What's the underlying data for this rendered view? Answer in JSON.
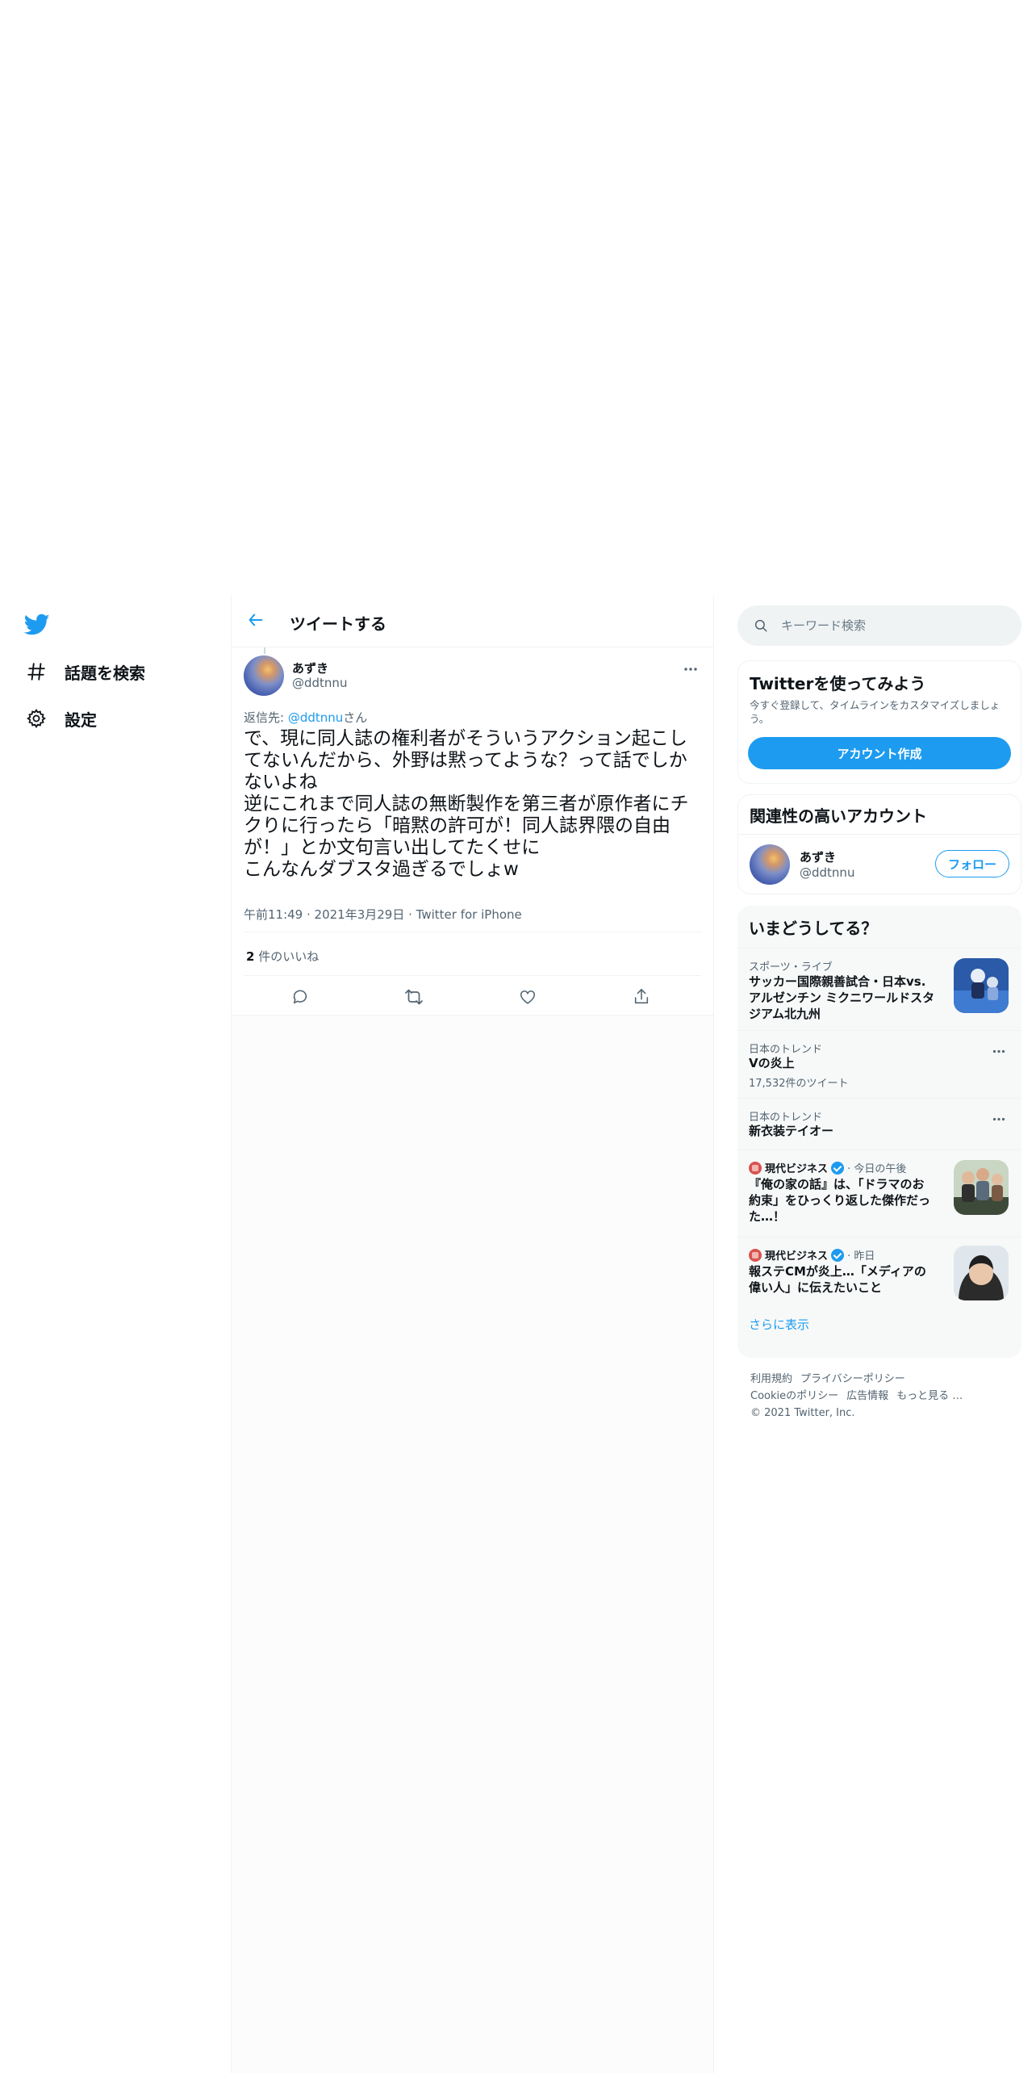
{
  "nav": {
    "logo": "twitter-bird-icon",
    "items": [
      {
        "label": "話題を検索",
        "icon": "hashtag-icon"
      },
      {
        "label": "設定",
        "icon": "gear-icon"
      }
    ]
  },
  "header": {
    "title": "ツイートする",
    "back_icon": "arrow-left-icon"
  },
  "tweet": {
    "display_name": "あずき",
    "handle": "@ddtnnu",
    "reply_prefix": "返信先: ",
    "reply_handle": "@ddtnnu",
    "reply_suffix": "さん",
    "body": "で、現に同人誌の権利者がそういうアクション起こしてないんだから、外野は黙ってような？って話でしかないよね\n逆にこれまで同人誌の無断製作を第三者が原作者にチクりに行ったら「暗黙の許可が！同人誌界隈の自由が！」とか文句言い出してたくせに\nこんなんダブスタ過ぎるでしょw",
    "time": "午前11:49",
    "date": "2021年3月29日",
    "source": "Twitter for iPhone",
    "like_count": "2",
    "like_label": " 件のいいね"
  },
  "search": {
    "placeholder": "キーワード検索"
  },
  "signup": {
    "title": "Twitterを使ってみよう",
    "text": "今すぐ登録して、タイムラインをカスタマイズしましょう。",
    "button": "アカウント作成"
  },
  "related": {
    "title": "関連性の高いアカウント",
    "name": "あずき",
    "handle": "@ddtnnu",
    "follow": "フォロー"
  },
  "trends": {
    "title": "いまどうしてる？",
    "items": [
      {
        "context": "スポーツ・ライブ",
        "title": "サッカー国際親善試合・日本vs.アルゼンチン ミクニワールドスタジアム北九州"
      },
      {
        "context": "日本のトレンド",
        "title": "Vの炎上",
        "count": "17,532件のツイート"
      },
      {
        "context": "日本のトレンド",
        "title": "新衣装テイオー"
      },
      {
        "publisher": "現代ビジネス",
        "when": "今日の午後",
        "title": "『俺の家の話』は、「ドラマのお約束」をひっくり返した傑作だった…！"
      },
      {
        "publisher": "現代ビジネス",
        "when": "昨日",
        "title": "報ステCMが炎上…「メディアの偉い人」に伝えたいこと"
      }
    ],
    "show_more": "さらに表示"
  },
  "footer": {
    "links": [
      "利用規約",
      "プライバシーポリシー",
      "Cookieのポリシー",
      "広告情報",
      "もっと見る …"
    ],
    "copyright": "© 2021 Twitter, Inc."
  },
  "colors": {
    "accent": "#1d9bf0",
    "text": "#0f1419",
    "secondary": "#536471"
  }
}
